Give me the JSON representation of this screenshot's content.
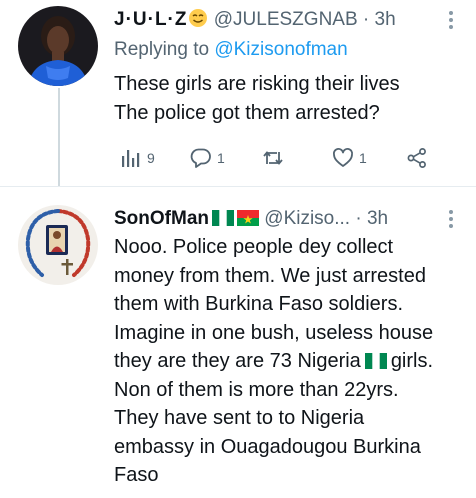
{
  "tweet1": {
    "display_name": "ᴶᵁᴸᶻ",
    "display_name_full": "J·U·L·Z",
    "handle": "@JULESZGNAB",
    "separator": "·",
    "time": "3h",
    "replying_label": "Replying to",
    "replying_mention": "@Kizisonofman",
    "lines": [
      "These girls are risking their lives",
      "The police got them arrested?"
    ],
    "views": "9",
    "replies": "1",
    "retweets": "",
    "likes": "1"
  },
  "tweet2": {
    "display_name": "SonOfMan",
    "handle": "@Kiziso...",
    "separator": "·",
    "time": "3h",
    "lines": [
      "Nooo. Police people dey collect",
      "money from them. We just arrested",
      "them with Burkina Faso soldiers.",
      "Imagine in one bush, useless house",
      "they are they are 73 Nigeria",
      "girls.",
      "Non of them is more than 22yrs.",
      "They have sent to to Nigeria",
      "embassy in Ouagadougou Burkina",
      "Faso"
    ]
  },
  "colors": {
    "accent": "#1d9bf0",
    "muted": "#536471",
    "text": "#0f1419",
    "nigeria_green": "#008751",
    "burkina_red": "#ef2b2d",
    "burkina_green": "#009e49",
    "star_yellow": "#fcd116"
  },
  "icons": [
    "views-icon",
    "reply-icon",
    "retweet-icon",
    "like-icon",
    "share-icon",
    "more-icon",
    "nigeria-flag-icon",
    "burkina-faso-flag-icon",
    "smiling-face-icon"
  ]
}
